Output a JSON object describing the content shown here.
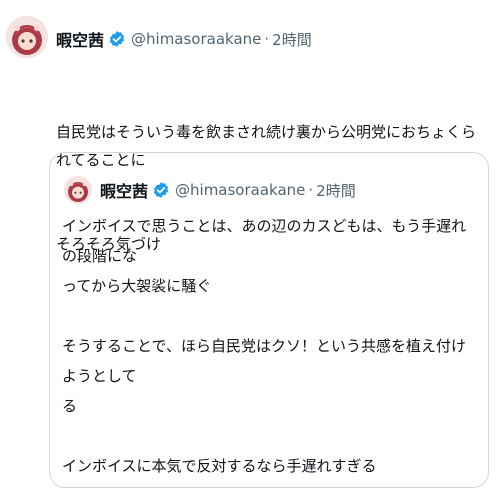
{
  "tweet": {
    "author": {
      "display_name": "暇空茜",
      "handle": "@himasoraakane",
      "separator": "·",
      "time": "2時間"
    },
    "text_lines": [
      "自民党はそういう毒を飲まされ続け裏から公明党におちょくられてることに",
      "そろそろ気づけ"
    ]
  },
  "quoted_tweet": {
    "author": {
      "display_name": "暇空茜",
      "handle": "@himasoraakane",
      "separator": "·",
      "time": "2時間"
    },
    "paragraphs": [
      "インボイスで思うことは、あの辺のカスどもは、もう手遅れの段階にな\nってから大袈裟に騒ぐ",
      "そうすることで、ほら自民党はクソ！という共感を植え付けようとして\nる",
      "インボイスに本気で反対するなら手遅れすぎる"
    ]
  },
  "colors": {
    "verified_badge": "#1d9bf0",
    "secondary_text": "#536471",
    "border": "#cfd9de"
  }
}
